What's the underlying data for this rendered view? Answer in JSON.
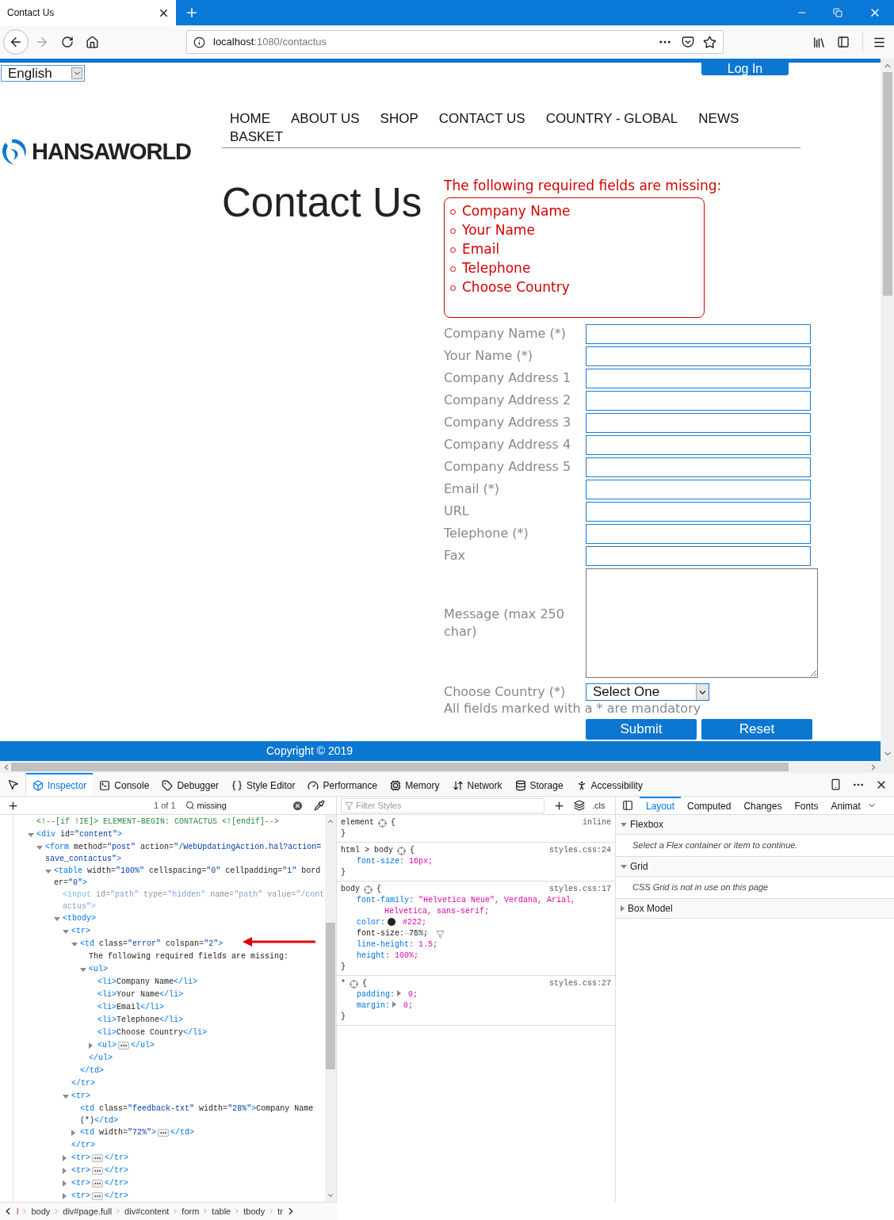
{
  "browser": {
    "tab_title": "Contact Us",
    "url_host": "localhost",
    "url_path": ":1080/contactus"
  },
  "page": {
    "language": "English",
    "login": "Log In",
    "logo": "HANSAWORLD",
    "nav": [
      {
        "label": "HOME"
      },
      {
        "label": "ABOUT US"
      },
      {
        "label": "SHOP"
      },
      {
        "label": "CONTACT US"
      },
      {
        "label": "COUNTRY - GLOBAL"
      },
      {
        "label": "NEWS"
      },
      {
        "label": "BASKET"
      }
    ],
    "heading": "Contact Us",
    "error_title": "The following required fields are missing:",
    "missing": [
      "Company Name",
      "Your Name",
      "Email",
      "Telephone",
      "Choose Country"
    ],
    "fields": [
      {
        "label": "Company Name (*)",
        "kind": "text"
      },
      {
        "label": "Your Name (*)",
        "kind": "text"
      },
      {
        "label": "Company Address 1",
        "kind": "text"
      },
      {
        "label": "Company Address 2",
        "kind": "text"
      },
      {
        "label": "Company Address 3",
        "kind": "text"
      },
      {
        "label": "Company Address 4",
        "kind": "text"
      },
      {
        "label": "Company Address 5",
        "kind": "text"
      },
      {
        "label": "Email (*)",
        "kind": "text"
      },
      {
        "label": "URL",
        "kind": "text"
      },
      {
        "label": "Telephone (*)",
        "kind": "text"
      },
      {
        "label": "Fax",
        "kind": "text"
      },
      {
        "label": "Message (max 250 char)",
        "kind": "textarea"
      },
      {
        "label": "Choose Country (*)",
        "kind": "select",
        "value": "Select One"
      }
    ],
    "note": "All fields marked with a * are mandatory",
    "buttons": [
      "Submit",
      "Reset"
    ],
    "footer": "Copyright © 2019"
  },
  "devtools": {
    "tabs": [
      {
        "label": "Inspector",
        "selected": true
      },
      {
        "label": "Console",
        "selected": false
      },
      {
        "label": "Debugger",
        "selected": false
      },
      {
        "label": "Style Editor",
        "selected": false
      },
      {
        "label": "Performance",
        "selected": false
      },
      {
        "label": "Memory",
        "selected": false
      },
      {
        "label": "Network",
        "selected": false
      },
      {
        "label": "Storage",
        "selected": false
      },
      {
        "label": "Accessibility",
        "selected": false
      }
    ],
    "search": {
      "count": "1 of 1",
      "value": "missing"
    },
    "filter": {
      "placeholder": "Filter Styles"
    },
    "cls": ".cls",
    "side_tabs": [
      {
        "label": "Layout",
        "selected": true
      },
      {
        "label": "Computed",
        "selected": false
      },
      {
        "label": "Changes",
        "selected": false
      },
      {
        "label": "Fonts",
        "selected": false
      },
      {
        "label": "Animat",
        "selected": false
      }
    ],
    "dom": [
      {
        "kind": "comment",
        "text": "<!--[if !IE]> ELEMENT-BEGIN: CONTACTUS <![endif]-->"
      },
      {
        "kind": "tag",
        "text": "<div id=\"content\">",
        "expanded": true,
        "children": [
          {
            "kind": "tag",
            "text": "<form method=\"post\" action=\"/WebUpdatingAction.hal?action=save_contactus\">",
            "expanded": true,
            "children": [
              {
                "kind": "tag",
                "text": "<table width=\"100%\" cellspacing=\"0\" cellpadding=\"1\" border=\"0\">",
                "expanded": true,
                "children": [
                  {
                    "kind": "hidden",
                    "text": "<input id=\"path\" type=\"hidden\" name=\"path\" value=\"/contactus\">"
                  },
                  {
                    "kind": "tag",
                    "text": "<tbody>",
                    "expanded": true,
                    "children": [
                      {
                        "kind": "tag",
                        "text": "<tr>",
                        "expanded": true,
                        "children": [
                          {
                            "kind": "tag",
                            "text": "<td class=\"error\" colspan=\"2\">",
                            "expanded": true,
                            "children": [
                              {
                                "kind": "text",
                                "text": "The following required fields are missing:"
                              },
                              {
                                "kind": "tag",
                                "text": "<ul>",
                                "expanded": true,
                                "children": [
                                  {
                                    "kind": "tag",
                                    "text": "<li>Company Name</li>"
                                  },
                                  {
                                    "kind": "tag",
                                    "text": "<li>Your Name</li>"
                                  },
                                  {
                                    "kind": "tag",
                                    "text": "<li>Email</li>"
                                  },
                                  {
                                    "kind": "tag",
                                    "text": "<li>Telephone</li>"
                                  },
                                  {
                                    "kind": "tag",
                                    "text": "<li>Choose Country</li>"
                                  },
                                  {
                                    "kind": "tag",
                                    "text": "<ul>",
                                    "expanded": false,
                                    "end": "</ul>"
                                  }
                                ]
                              },
                              {
                                "kind": "tag",
                                "text": "</ul>"
                              }
                            ]
                          },
                          {
                            "kind": "tag",
                            "text": "</td>"
                          }
                        ]
                      },
                      {
                        "kind": "tag",
                        "text": "</tr>"
                      },
                      {
                        "kind": "tag",
                        "text": "<tr>",
                        "expanded": true,
                        "children": [
                          {
                            "kind": "tag",
                            "text": "<td class=\"feedback-txt\" width=\"28%\">Company Name (*)</td>"
                          },
                          {
                            "kind": "tag",
                            "text": "<td width=\"72%\">",
                            "expanded": false,
                            "end": "</td>"
                          }
                        ]
                      },
                      {
                        "kind": "tag",
                        "text": "</tr>"
                      },
                      {
                        "kind": "tag",
                        "text": "<tr>",
                        "expanded": false,
                        "end": "</tr>"
                      },
                      {
                        "kind": "tag",
                        "text": "<tr>",
                        "expanded": false,
                        "end": "</tr>"
                      },
                      {
                        "kind": "tag",
                        "text": "<tr>",
                        "expanded": false,
                        "end": "</tr>"
                      },
                      {
                        "kind": "tag",
                        "text": "<tr>",
                        "expanded": false,
                        "end": "</tr>"
                      }
                    ]
                  }
                ]
              }
            ]
          }
        ]
      }
    ],
    "rules": [
      {
        "selector": "element",
        "open": "{",
        "source": "inline",
        "close": "}"
      },
      {
        "selector": "html > body",
        "open": "{",
        "source": "styles.css:24",
        "close": "}",
        "declarations": [
          {
            "text": "font-size: 16px;",
            "overridden": false
          }
        ]
      },
      {
        "selector": "body",
        "open": "{",
        "source": "styles.css:17",
        "close": "}",
        "declarations": [
          {
            "text": "font-family: \"Helvetica Neue\", Verdana, Arial, Helvetica, sans-serif;",
            "overridden": false
          },
          {
            "text": "color: #222;",
            "overridden": false,
            "color": "#222222"
          },
          {
            "text": "font-size: 75%;",
            "overridden": true
          },
          {
            "text": "line-height: 1.5;",
            "overridden": false
          },
          {
            "text": "height: 100%;",
            "overridden": false
          }
        ]
      },
      {
        "selector": "*",
        "open": "{",
        "source": "styles.css:27",
        "close": "}",
        "declarations": [
          {
            "text": "padding: 0;",
            "overridden": false,
            "expandable": true
          },
          {
            "text": "margin: 0;",
            "overridden": false,
            "expandable": true
          }
        ]
      }
    ],
    "layout_sections": [
      {
        "title": "Flexbox",
        "expanded": true,
        "message": "Select a Flex container or item to continue."
      },
      {
        "title": "Grid",
        "expanded": true,
        "message": "CSS Grid is not in use on this page"
      },
      {
        "title": "Box Model",
        "expanded": false
      }
    ],
    "breadcrumbs": [
      "l",
      "body",
      "div#page.full",
      "div#content",
      "form",
      "table",
      "tbody",
      "tr"
    ]
  }
}
